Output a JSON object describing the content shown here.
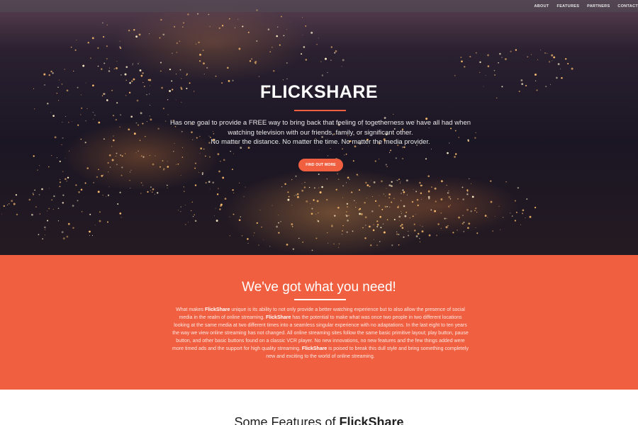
{
  "nav": {
    "items": [
      "ABOUT",
      "FEATURES",
      "PARTNERS",
      "CONTACT"
    ]
  },
  "hero": {
    "title": "FLICKSHARE",
    "line1": "Has one goal to provide a FREE way to bring back that feeling of togetherness we have all had when watching television with our friends, family, or significant other.",
    "line2": "No matter the distance. No matter the time. No matter the media provider.",
    "button": "FIND OUT MORE"
  },
  "about": {
    "title": "We've got what you need!",
    "p1": "What makes ",
    "brand": "FlickShare",
    "p2": " unique is its ability to not only provide a better watching experience but to also allow the presence of social media in the realm of online streaming. ",
    "p3": " has the potential to make what was once two people in two different locations looking at the same media at two different times into a seamless singular experience with no adaptations. In the last eight to ten years the way we view online streaming has not changed. All online streaming sites follow the same basic primitive layout; play button, pause button, and other basic buttons found on a classic VCR player. No new innovations, no new features and the few things added were more timed ads and the support for high quality streaming. ",
    "p4": " is poised to break this dull style and bring something completely new and exciting to the world of online streaming."
  },
  "features": {
    "title_prefix": "Some Features of ",
    "title_brand": "FlickShare"
  },
  "colors": {
    "accent": "#f05f40",
    "nav_bg": "#504c56"
  }
}
